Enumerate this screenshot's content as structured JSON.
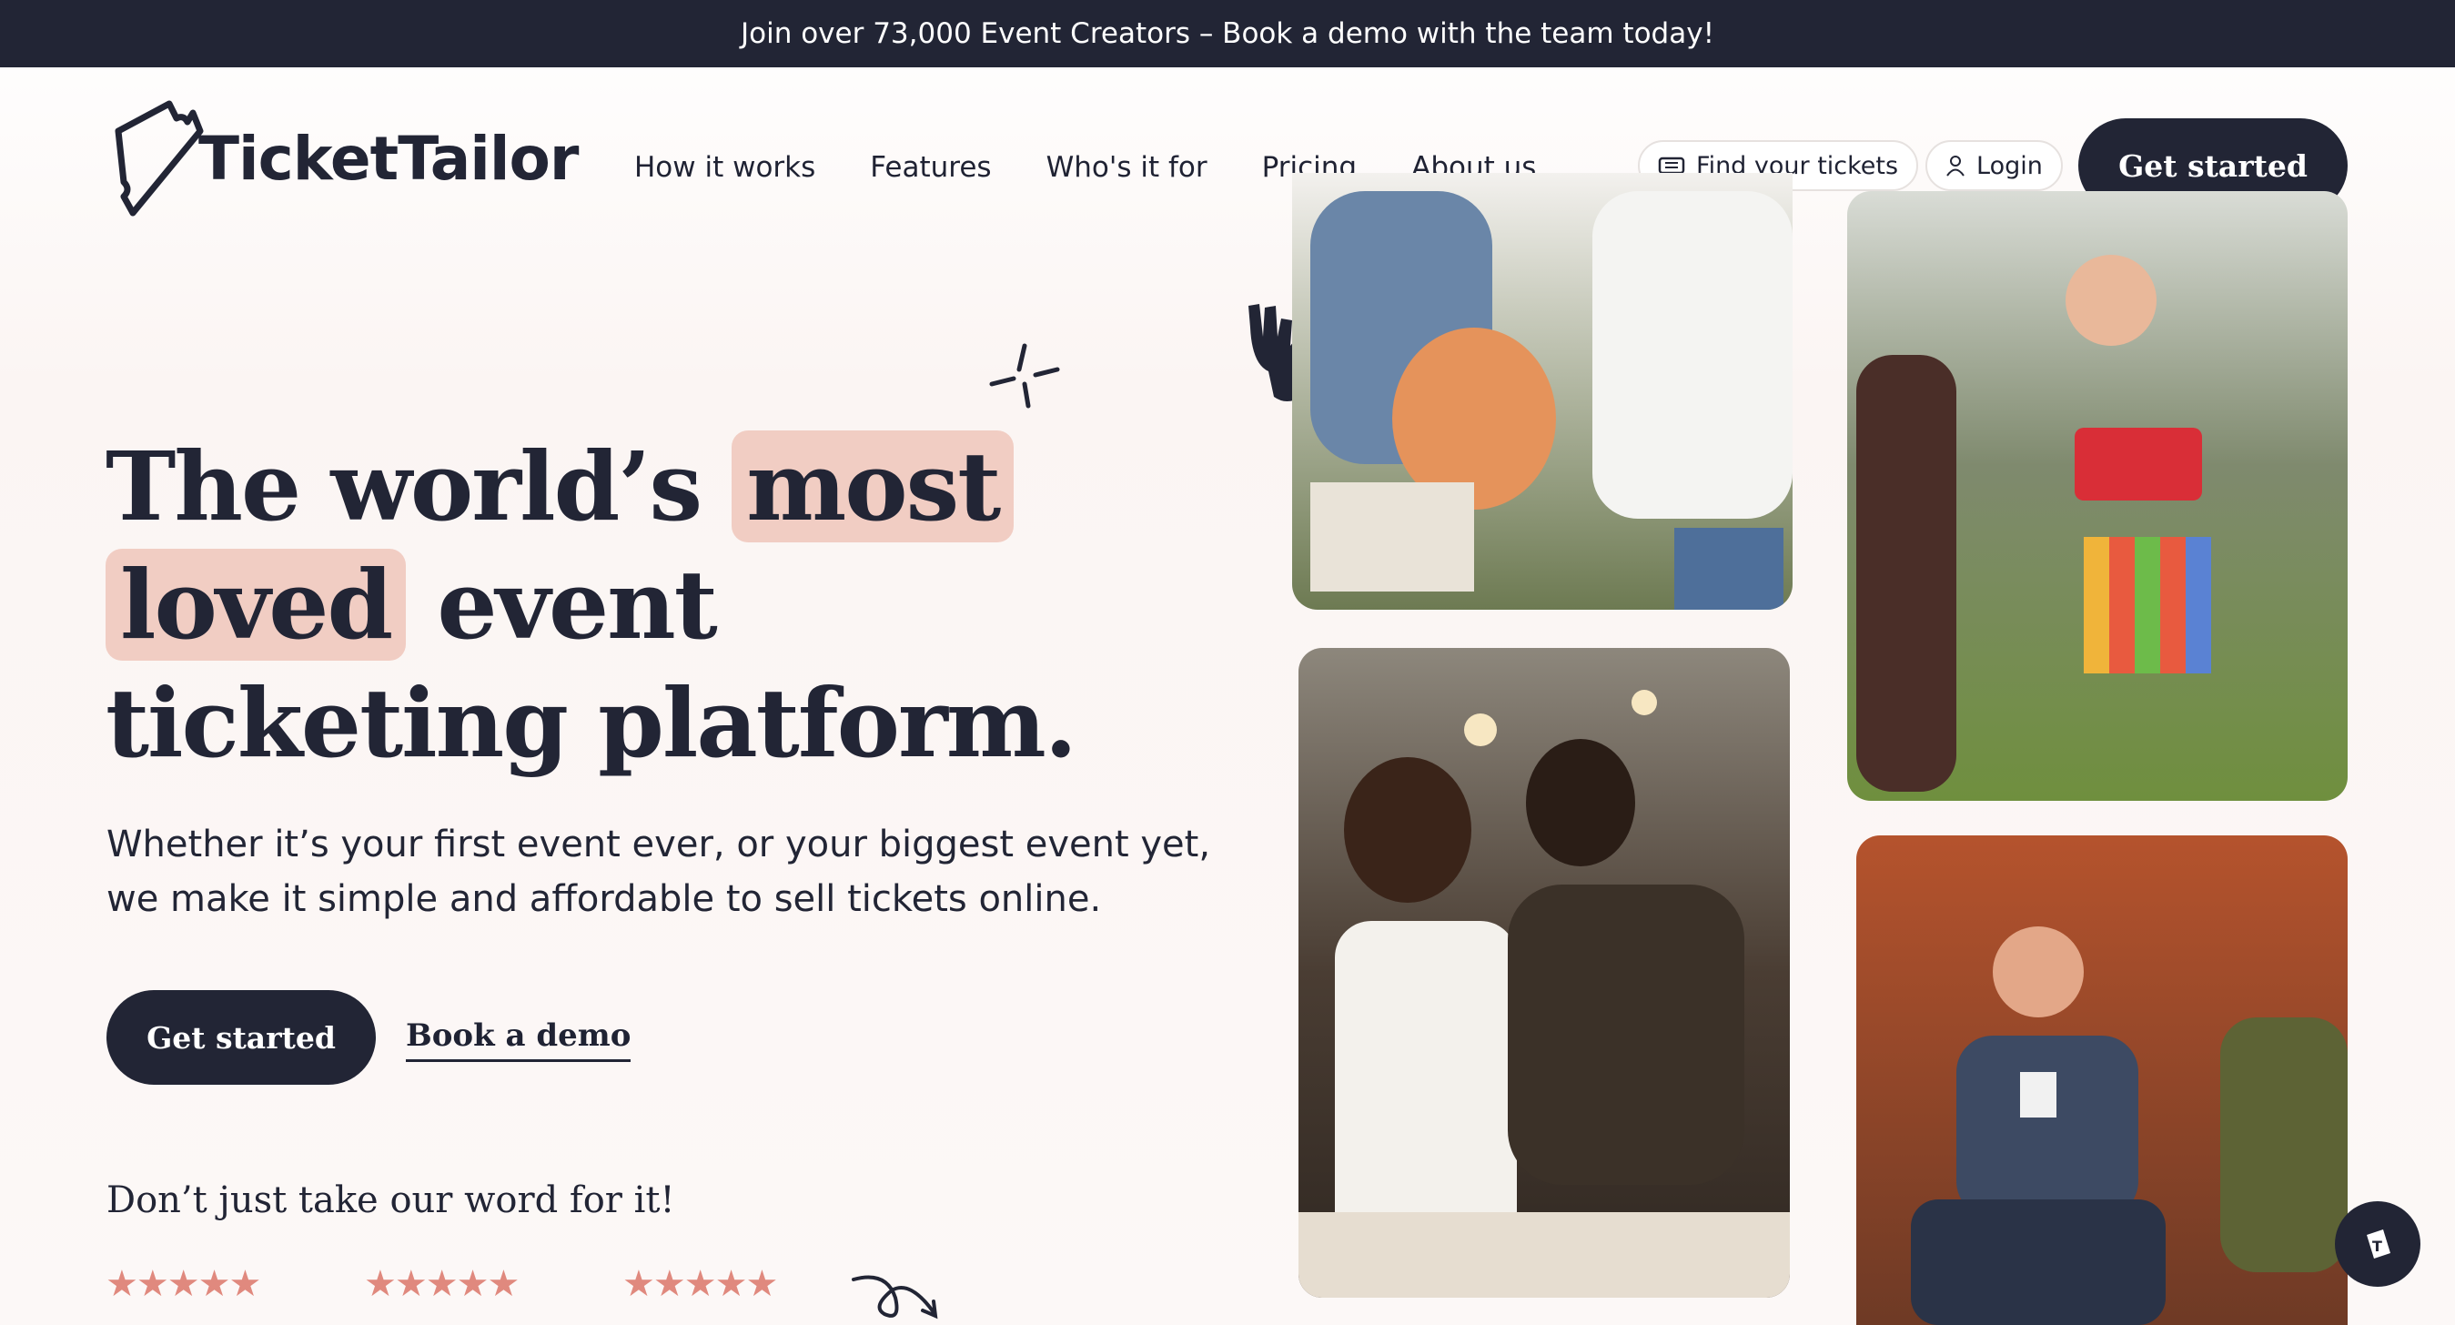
{
  "banner": {
    "text": "Join over 73,000 Event Creators – Book a demo with the team today!"
  },
  "logo": {
    "wordmark": "TicketTailor"
  },
  "nav": {
    "items": [
      "How it works",
      "Features",
      "Who's it for",
      "Pricing",
      "About us"
    ],
    "find_tickets": "Find your tickets",
    "login": "Login",
    "get_started": "Get started"
  },
  "hero": {
    "line1_pre": "The world’s ",
    "line1_hl": "most",
    "line2_hl": "loved",
    "line2_post": " event",
    "line3": "ticketing platform.",
    "subtitle_line1": "Whether it’s your first event ever, or your biggest event yet,",
    "subtitle_line2": "we make it simple and affordable to sell tickets online.",
    "cta_primary": "Get started",
    "cta_secondary": "Book a demo"
  },
  "reviews": {
    "heading": "Don’t just take our word for it!",
    "ratings": [
      {
        "stars": "★★★★★",
        "value": 5
      },
      {
        "stars": "★★★★★",
        "value": 5
      },
      {
        "stars": "★★★★★",
        "value": 5
      }
    ]
  },
  "photos": [
    {
      "subject": "two people holding a pumpkin"
    },
    {
      "subject": "woman dancing at a festival"
    },
    {
      "subject": "women at a crafting workshop"
    },
    {
      "subject": "man speaking on a panel"
    }
  ],
  "icons": {
    "ticket": "ticket-icon",
    "user": "user-icon",
    "chat": "chat-widget-icon",
    "sparkle": "sparkle-icon",
    "hand": "ok-hand-icon",
    "arrow": "curly-arrow-icon"
  },
  "colors": {
    "dark": "#222535",
    "highlight": "#f1cdc3",
    "stars": "#e0897e"
  }
}
